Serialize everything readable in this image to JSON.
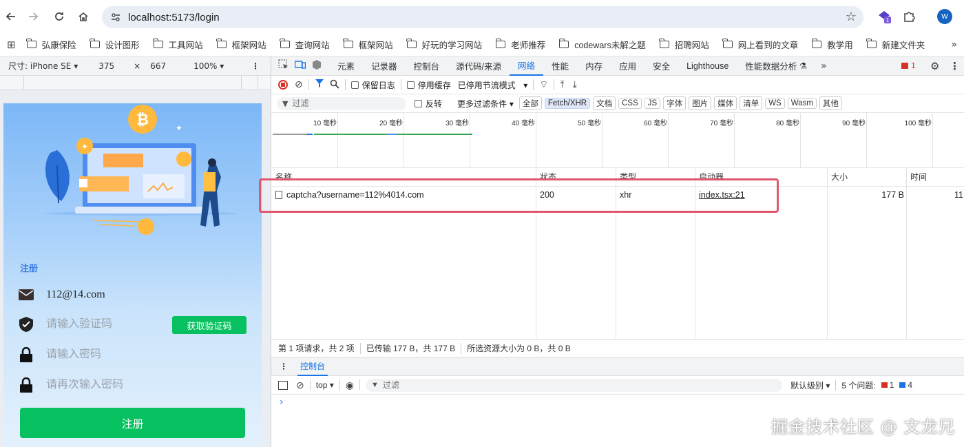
{
  "browser": {
    "url": "localhost:5173/login",
    "profile_initial": "W",
    "ext_badge": "1"
  },
  "bookmarks": [
    "弘康保险",
    "设计图形",
    "工具网站",
    "框架网站",
    "查询网站",
    "框架网站",
    "好玩的学习网站",
    "老师推荐",
    "codewars未解之题",
    "招聘网站",
    "网上看到的文章",
    "教学用",
    "新建文件夹"
  ],
  "device_toolbar": {
    "device_label": "尺寸: iPhone SE",
    "width": "375",
    "times": "×",
    "height": "667",
    "zoom": "100%"
  },
  "mobile": {
    "section_title": "注册",
    "email_value": "112@14.com",
    "code_placeholder": "请输入验证码",
    "code_button": "获取验证码",
    "password_placeholder": "请输入密码",
    "password2_placeholder": "请再次输入密码",
    "register_button": "注册"
  },
  "devtools": {
    "tabs": [
      "元素",
      "记录器",
      "控制台",
      "源代码/来源",
      "网络",
      "性能",
      "内存",
      "应用",
      "安全",
      "Lighthouse",
      "性能数据分析"
    ],
    "active_tab": "网络",
    "issues_count": "1",
    "toolbar1": {
      "preserve_log": "保留日志",
      "disable_cache": "停用缓存",
      "throttle": "已停用节流模式"
    },
    "toolbar2": {
      "filter_placeholder": "过滤",
      "invert": "反转",
      "more_filters": "更多过滤条件",
      "chips": [
        "全部",
        "Fetch/XHR",
        "文档",
        "CSS",
        "JS",
        "字体",
        "图片",
        "媒体",
        "清单",
        "WS",
        "Wasm",
        "其他"
      ],
      "active_chip": "Fetch/XHR"
    },
    "timeline_labels": [
      "10 毫秒",
      "20 毫秒",
      "30 毫秒",
      "40 毫秒",
      "50 毫秒",
      "60 毫秒",
      "70 毫秒",
      "80 毫秒",
      "90 毫秒",
      "100 毫秒"
    ],
    "table": {
      "columns": [
        "名称",
        "状态",
        "类型",
        "启动器",
        "大小",
        "时间"
      ],
      "rows": [
        {
          "name": "captcha?username=112%4014.com",
          "status": "200",
          "type": "xhr",
          "initiator": "index.tsx:21",
          "size": "177 B",
          "time": "11"
        }
      ]
    },
    "status": {
      "requests": "第 1 项请求，共 2 项",
      "transferred": "已传输 177 B，共 177 B",
      "resources": "所选资源大小为 0 B，共 0 B"
    },
    "drawer": {
      "tab": "控制台",
      "context": "top",
      "filter_placeholder": "过滤",
      "level": "默认级别",
      "issues_label": "5 个问题:",
      "errors": "1",
      "infos": "4"
    }
  },
  "watermark": "掘金技术社区 @ 文龙兄",
  "colors": {
    "accent_blue": "#1a73e8",
    "green": "#07c160",
    "highlight": "#e0566e"
  }
}
